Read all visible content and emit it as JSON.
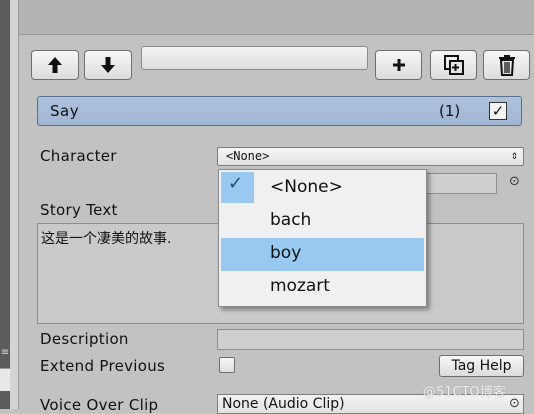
{
  "toolbar": {
    "up_icon": "arrow-up-icon",
    "down_icon": "arrow-down-icon",
    "add_icon": "plus-icon",
    "duplicate_icon": "duplicate-icon",
    "delete_icon": "trash-icon",
    "search_value": ""
  },
  "command": {
    "title": "Say",
    "count": "(1)",
    "enabled": true
  },
  "fields": {
    "character_label": "Character",
    "character_value": "<None>",
    "story_label": "Story Text",
    "story_text": "这是一个凄美的故事.",
    "description_label": "Description",
    "description_value": "",
    "extend_label": "Extend Previous",
    "extend_checked": false,
    "tag_help_label": "Tag Help",
    "voice_label": "Voice Over Clip",
    "voice_value": "None (Audio Clip)"
  },
  "dropdown": {
    "options": [
      {
        "label": "<None>",
        "checked": true
      },
      {
        "label": "bach",
        "checked": false
      },
      {
        "label": "boy",
        "checked": false,
        "highlighted": true
      },
      {
        "label": "mozart",
        "checked": false
      }
    ]
  },
  "watermark": "@51CTO博客",
  "colors": {
    "header_blue": "#aec3dd",
    "highlight_blue": "#99c9f1",
    "panel_gray": "#c2c2c2"
  }
}
